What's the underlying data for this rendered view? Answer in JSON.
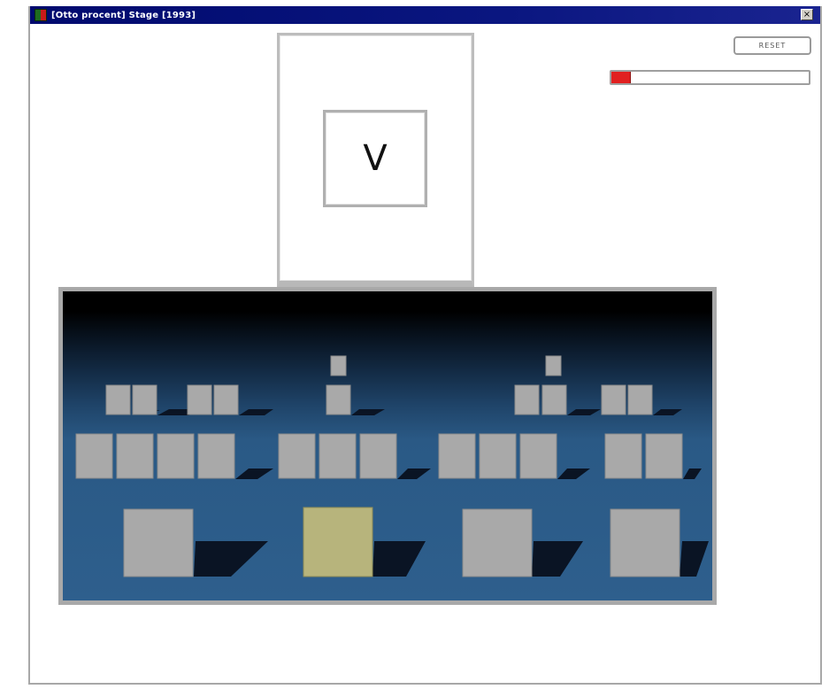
{
  "window": {
    "title": "[Otto procent] Stage [1993]",
    "close_label": "×"
  },
  "stimulus": {
    "letter": "V"
  },
  "controls": {
    "reset_label": "RESET"
  },
  "progress": {
    "fraction": 0.1,
    "color": "#e12020"
  },
  "scene": {
    "icon": "3d-blocks-board",
    "floor_color": "#2e5f8d",
    "block_color": "#a9a9a9",
    "highlight_color": "#b7b47c",
    "shadow_color": "#0a1424",
    "groups": [
      {
        "top_blocks": 0,
        "mid_blocks": 4,
        "small_blocks": [
          2,
          2
        ],
        "big_block_highlighted": false
      },
      {
        "top_blocks": 2,
        "mid_blocks": 3,
        "small_blocks": [],
        "big_block_highlighted": true
      },
      {
        "top_blocks": 1,
        "mid_blocks": 3,
        "small_blocks": [
          2
        ],
        "big_block_highlighted": false
      },
      {
        "top_blocks": 0,
        "mid_blocks": 2,
        "small_blocks": [
          2
        ],
        "big_block_highlighted": false
      }
    ]
  }
}
